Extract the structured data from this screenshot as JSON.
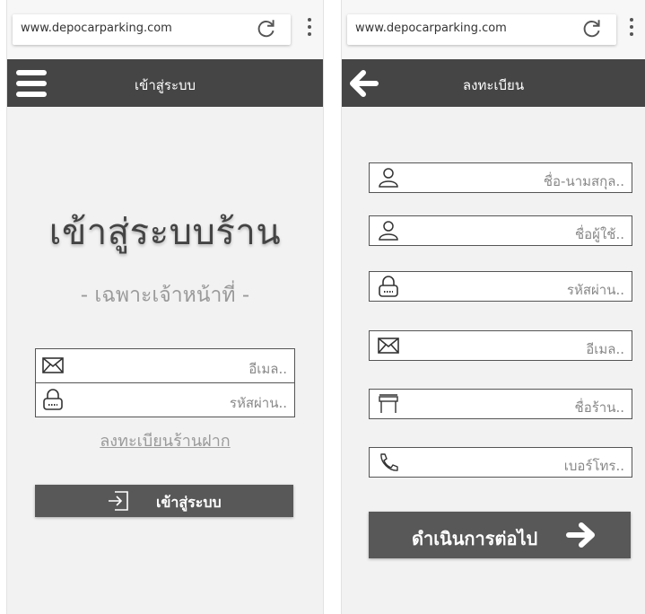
{
  "login_screen": {
    "browser": {
      "url": "www.depocarparking.com"
    },
    "appbar": {
      "title": "เข้าสู่ระบบ"
    },
    "heading": "เข้าสู่ระบบร้าน",
    "subheading": "- เฉพาะเจ้าหน้าที่ -",
    "email_placeholder": "อีเมล..",
    "password_placeholder": "รหัสผ่าน..",
    "register_link": "ลงทะเบียนร้านฝาก",
    "login_button": "เข้าสู่ระบบ"
  },
  "register_screen": {
    "browser": {
      "url": "www.depocarparking.com"
    },
    "appbar": {
      "title": "ลงทะเบียน"
    },
    "fields": [
      {
        "placeholder": "ชื่อ-นามสกุล..",
        "icon": "user-icon"
      },
      {
        "placeholder": "ชื่อผู้ใช้..",
        "icon": "user-icon"
      },
      {
        "placeholder": "รหัสผ่าน..",
        "icon": "lock-icon"
      },
      {
        "placeholder": "อีเมล..",
        "icon": "envelope-icon"
      },
      {
        "placeholder": "ชื่อร้าน..",
        "icon": "shop-icon"
      },
      {
        "placeholder": "เบอร์โทร..",
        "icon": "phone-icon"
      }
    ],
    "continue_button": "ดำเนินการต่อไป"
  },
  "colors": {
    "appbar": "#454545",
    "button": "#585858",
    "screen_bg": "#f2f2f2",
    "muted_text": "#9a9a9a"
  }
}
